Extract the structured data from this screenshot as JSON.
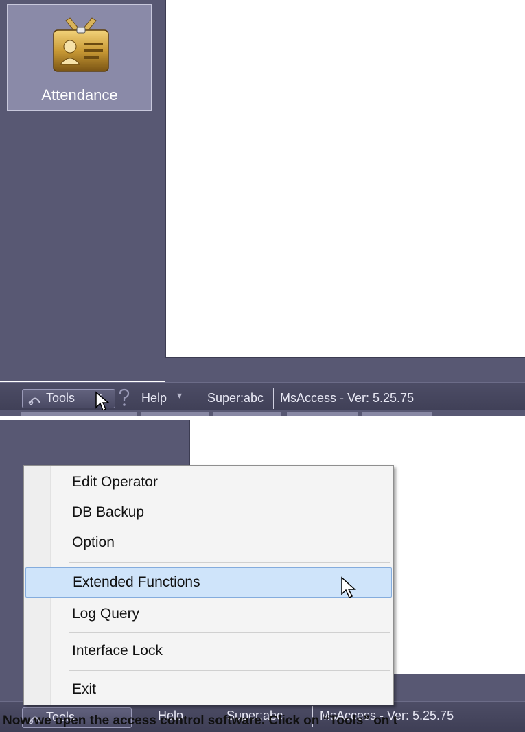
{
  "top_screenshot": {
    "tile": {
      "label": "Attendance",
      "icon": "attendance-badge-icon"
    },
    "statusbar": {
      "tools_label": "Tools",
      "help_label": "Help",
      "dropdown_arrow": "▾",
      "user_text": "Super:abc",
      "db_version_text": "MsAccess - Ver: 5.25.75"
    }
  },
  "bottom_screenshot": {
    "menu": {
      "items": [
        {
          "label": "Edit Operator"
        },
        {
          "label": "DB Backup"
        },
        {
          "label": "Option"
        },
        {
          "label": "Extended Functions",
          "highlighted": true
        },
        {
          "label": "Log Query"
        },
        {
          "label": "Interface Lock"
        },
        {
          "label": "Exit"
        }
      ]
    },
    "statusbar": {
      "tools_label": "Tools",
      "help_label": "Help",
      "user_text": "Super:abc",
      "db_version_text": "MsAccess - Ver: 5.25.75"
    }
  },
  "caption": "Now we open the access control software. Click on “Tools” on t",
  "colors": {
    "sidebar": "#585873",
    "statusbar": "#45455d",
    "menu_highlight": "#cfe4fa",
    "menu_highlight_border": "#84acdd"
  }
}
